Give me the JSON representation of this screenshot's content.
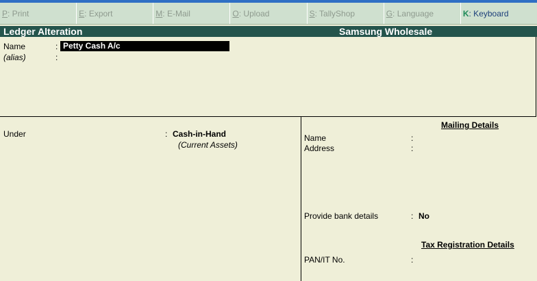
{
  "menu": [
    {
      "key": "P",
      "label": ": Print"
    },
    {
      "key": "E",
      "label": ": Export"
    },
    {
      "key": "M",
      "label": ": E-Mail"
    },
    {
      "key": "O",
      "label": ": Upload"
    },
    {
      "key": "S",
      "label": ": TallyShop"
    },
    {
      "key": "G",
      "label": ": Language"
    },
    {
      "key": "K",
      "label": ": Keyboard"
    }
  ],
  "title": {
    "screen": "Ledger Alteration",
    "company": "Samsung Wholesale"
  },
  "ledger": {
    "name_label": "Name",
    "alias_label": "(alias)",
    "colon": ":",
    "name_value": "Petty Cash A/c"
  },
  "group": {
    "under_label": "Under",
    "colon": ":",
    "group_name": "Cash-in-Hand",
    "parent_group": "(Current Assets)"
  },
  "mailing": {
    "heading": "Mailing Details",
    "name_label": "Name",
    "address_label": "Address",
    "colon": ":",
    "bank_label": "Provide bank details",
    "bank_value": "No"
  },
  "tax": {
    "heading": "Tax Registration Details",
    "pan_label": "PAN/IT No.",
    "colon": ":"
  }
}
